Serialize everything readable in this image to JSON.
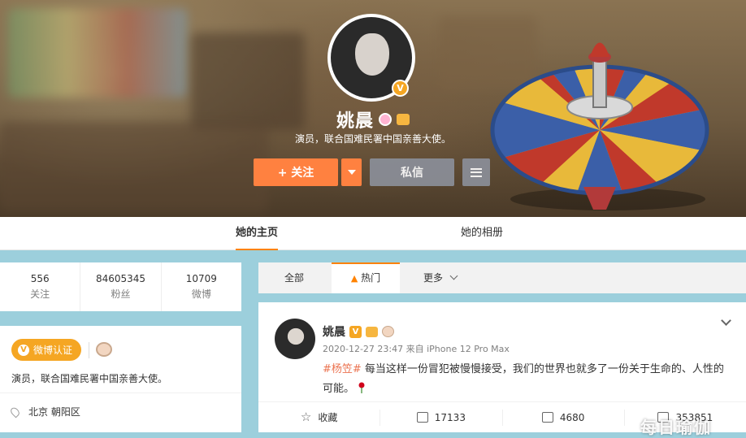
{
  "profile": {
    "name": "姚晨",
    "description": "演员，联合国难民署中国亲善大使。",
    "verified_mark": "V"
  },
  "actions": {
    "follow_label": "+ 关注",
    "message_label": "私信"
  },
  "tabs": {
    "home": "她的主页",
    "album": "她的相册"
  },
  "stats": [
    {
      "value": "556",
      "label": "关注"
    },
    {
      "value": "84605345",
      "label": "粉丝"
    },
    {
      "value": "10709",
      "label": "微博"
    }
  ],
  "info": {
    "verify_label": "微博认证",
    "description": "演员，联合国难民署中国亲善大使。",
    "location": "北京 朝阳区"
  },
  "feed_tabs": {
    "all": "全部",
    "hot": "热门",
    "more": "更多"
  },
  "post": {
    "author": "姚晨",
    "meta": "2020-12-27 23:47 来自 iPhone 12 Pro Max",
    "topic": "#杨笠#",
    "text": " 每当这样一份冒犯被慢慢接受，我们的世界也就多了一份关于生命的、人性的可能。",
    "actions": {
      "favorite": "收藏",
      "repost": "17133",
      "comment": "4680",
      "like": "353851"
    }
  },
  "watermark": "每日瑜伽",
  "colors": {
    "accent": "#ff8140",
    "orange": "#ff8200",
    "verify": "#f5a623",
    "topic": "#eb7350"
  }
}
